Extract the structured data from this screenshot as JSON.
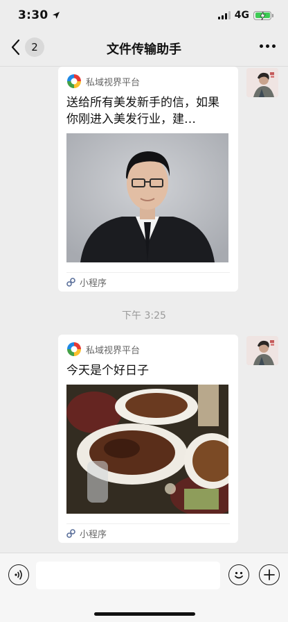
{
  "status_bar": {
    "time": "3:30",
    "network": "4G"
  },
  "nav": {
    "unread_count": "2",
    "title": "文件传输助手"
  },
  "messages": [
    {
      "source": "私域视界平台",
      "title": "送给所有美发新手的信，如果你刚进入美发行业，建…",
      "footer": "小程序"
    },
    {
      "source": "私域视界平台",
      "title": "今天是个好日子",
      "footer": "小程序"
    }
  ],
  "timestamp": "下午 3:25",
  "colors": {
    "background": "#ededed",
    "card": "#ffffff",
    "battery": "#3ecb55"
  }
}
